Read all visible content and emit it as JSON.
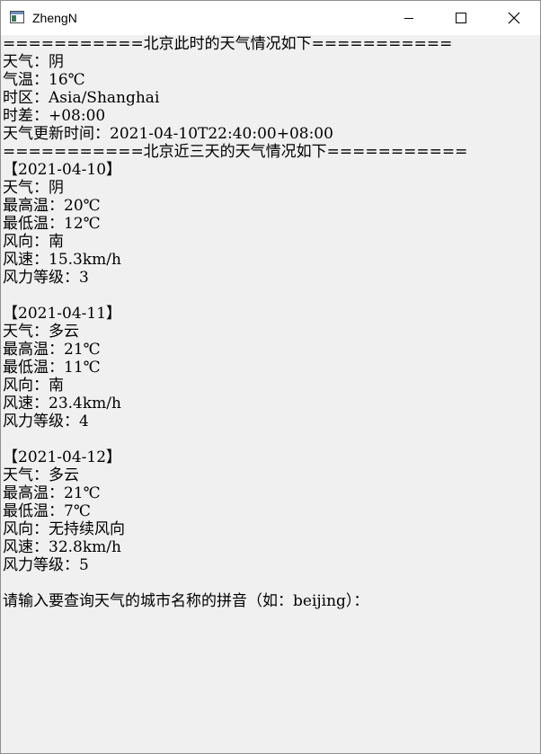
{
  "window": {
    "title": "ZhengN"
  },
  "console": {
    "lines": [
      "===========北京此时的天气情况如下===========",
      "天气：阴",
      "气温：16℃",
      "时区：Asia/Shanghai",
      "时差：+08:00",
      "天气更新时间：2021-04-10T22:40:00+08:00",
      "===========北京近三天的天气情况如下===========",
      "【2021-04-10】",
      "天气：阴",
      "最高温：20℃",
      "最低温：12℃",
      "风向：南",
      "风速：15.3km/h",
      "风力等级：3",
      "",
      "【2021-04-11】",
      "天气：多云",
      "最高温：21℃",
      "最低温：11℃",
      "风向：南",
      "风速：23.4km/h",
      "风力等级：4",
      "",
      "【2021-04-12】",
      "天气：多云",
      "最高温：21℃",
      "最低温：7℃",
      "风向：无持续风向",
      "风速：32.8km/h",
      "风力等级：5",
      "",
      "请输入要查询天气的城市名称的拼音（如：beijing）："
    ]
  }
}
